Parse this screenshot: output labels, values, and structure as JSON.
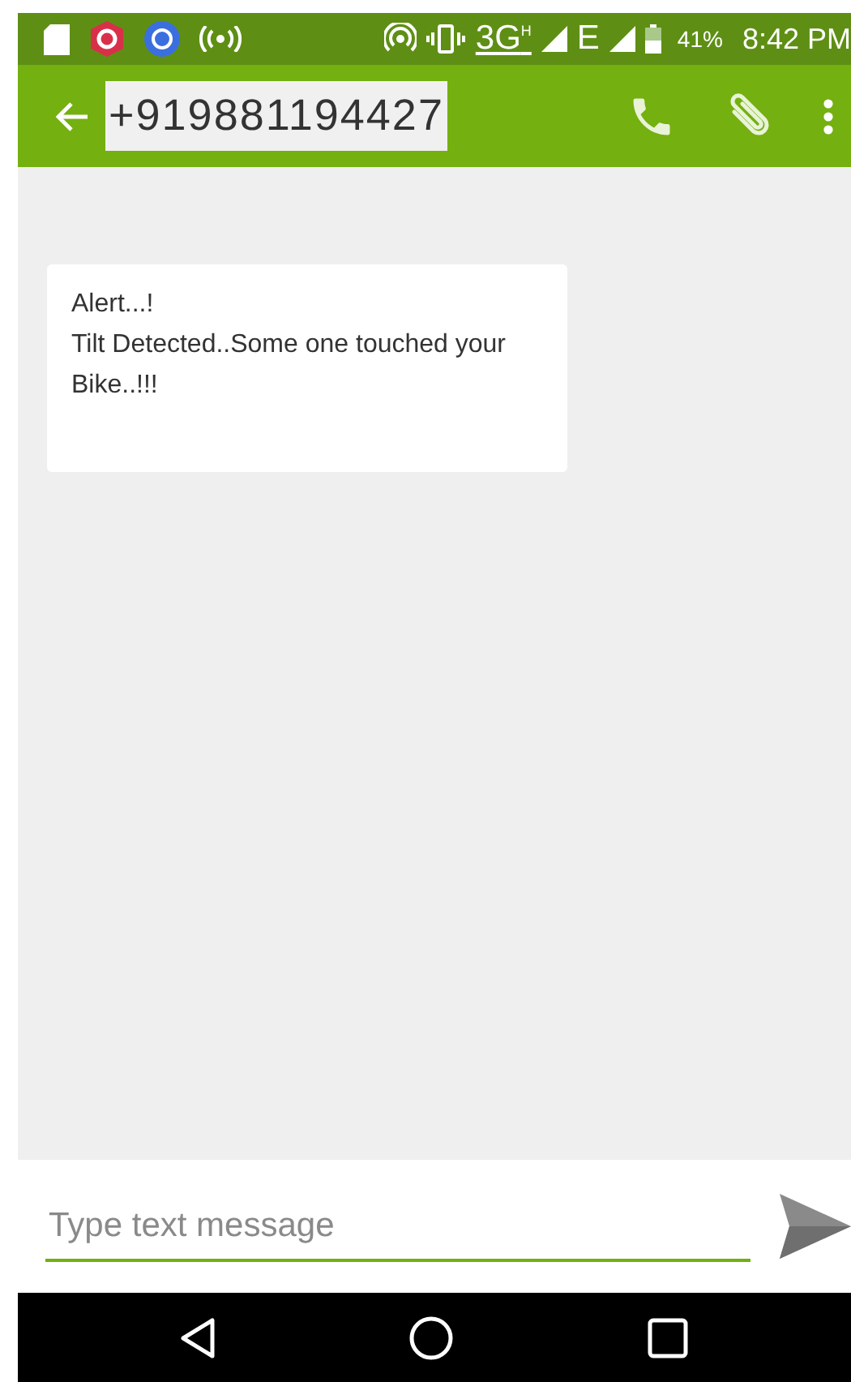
{
  "status_bar": {
    "network": "3G",
    "network_sup": "H",
    "network_2": "E",
    "battery": "41%",
    "time": "8:42 PM"
  },
  "app_bar": {
    "title": "+919881194427",
    "title_selected": true
  },
  "messages": [
    {
      "lines": [
        "Alert...!",
        "Tilt Detected..Some one touched your Bike..!!!"
      ]
    }
  ],
  "composer": {
    "placeholder": "Type text message"
  }
}
